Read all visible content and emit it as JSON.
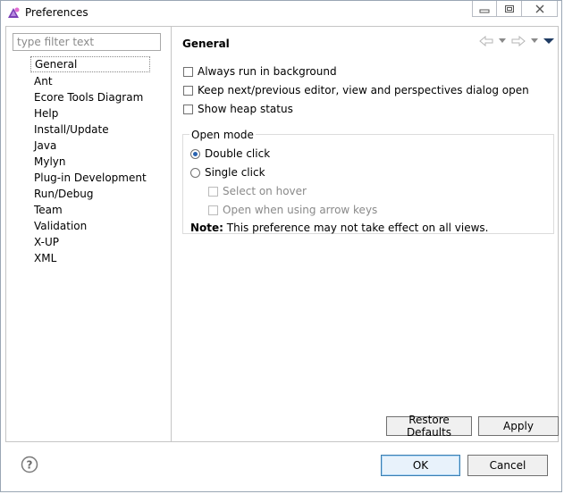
{
  "window": {
    "title": "Preferences"
  },
  "filter": {
    "placeholder": "type filter text"
  },
  "tree": {
    "items": [
      "General",
      "Ant",
      "Ecore Tools Diagram",
      "Help",
      "Install/Update",
      "Java",
      "Mylyn",
      "Plug-in Development",
      "Run/Debug",
      "Team",
      "Validation",
      "X-UP",
      "XML"
    ],
    "selected": "General"
  },
  "page": {
    "title": "General",
    "options": {
      "always_run": "Always run in background",
      "keep_next": "Keep next/previous editor, view and perspectives dialog open",
      "show_heap": "Show heap status"
    },
    "open_mode": {
      "label": "Open mode",
      "double_click": "Double click",
      "single_click": "Single click",
      "select_on_hover": "Select on hover",
      "open_arrow": "Open when using arrow keys",
      "selected": "Double click"
    },
    "note_bold": "Note:",
    "note_text": " This preference may not take effect on all views.",
    "restore_defaults": "Restore Defaults",
    "apply": "Apply"
  },
  "footer": {
    "ok": "OK",
    "cancel": "Cancel"
  },
  "icons": [
    "app-icon",
    "minimize-icon",
    "restore-icon",
    "close-icon",
    "back-arrow-icon",
    "forward-arrow-icon",
    "view-menu-icon",
    "help-icon"
  ]
}
